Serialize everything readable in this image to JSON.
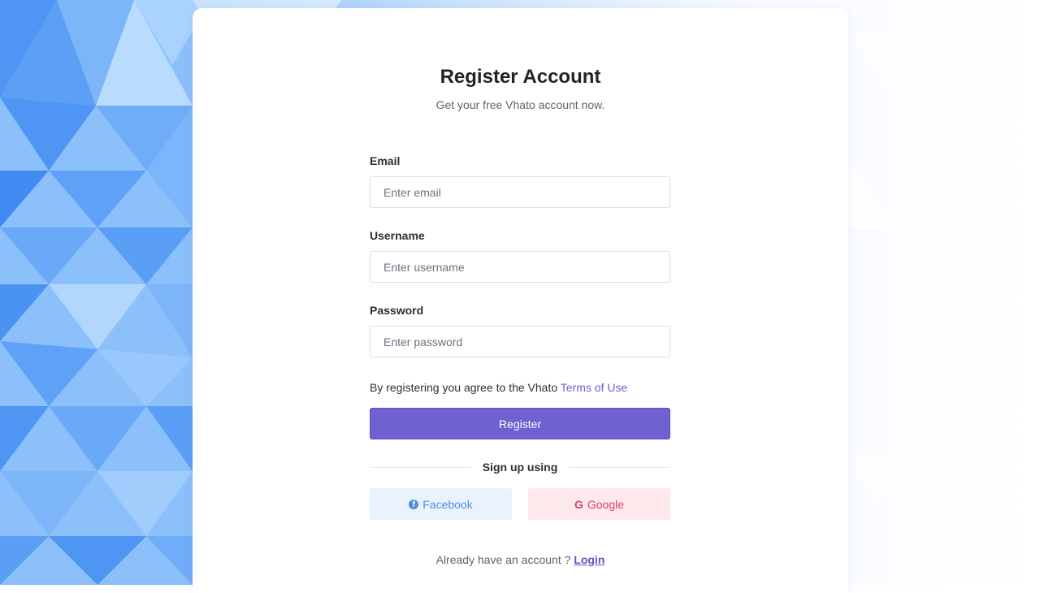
{
  "page": {
    "title": "Register Account",
    "subtitle": "Get your free Vhato account now."
  },
  "form": {
    "email": {
      "label": "Email",
      "placeholder": "Enter email",
      "value": ""
    },
    "username": {
      "label": "Username",
      "placeholder": "Enter username",
      "value": ""
    },
    "password": {
      "label": "Password",
      "placeholder": "Enter password",
      "value": ""
    },
    "terms": {
      "text": "By registering you agree to the Vhato ",
      "link": "Terms of Use"
    },
    "register_label": "Register"
  },
  "social": {
    "divider_label": "Sign up using",
    "facebook": {
      "label": "Facebook",
      "icon": "facebook-icon"
    },
    "google": {
      "label": "Google",
      "icon": "google-icon"
    }
  },
  "footer": {
    "prompt": "Already have an account ? ",
    "login_label": "Login"
  },
  "colors": {
    "accent": "#6f62d0",
    "facebook": "#4a90e2",
    "google": "#e0405e",
    "background_pattern": "#5b9ff5"
  }
}
